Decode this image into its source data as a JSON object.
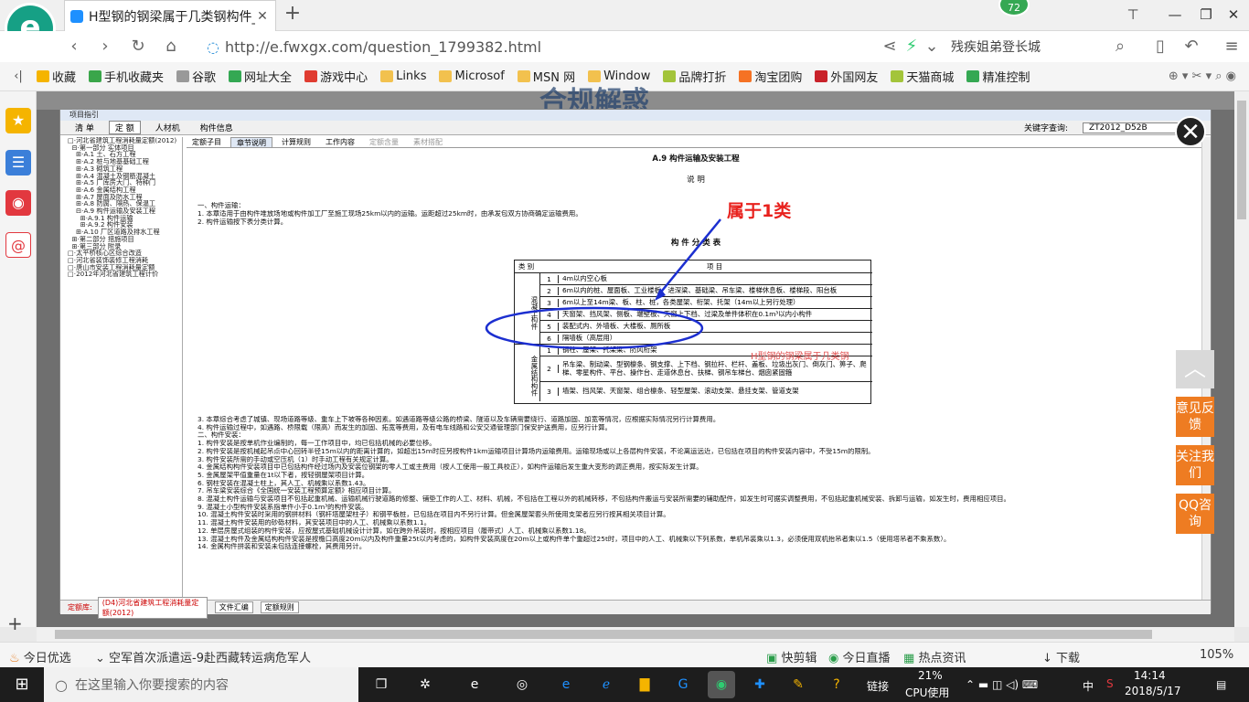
{
  "browser": {
    "logo_glyph": "e",
    "tab_title": "H型钢的钢梁属于几类钢构件_广",
    "tab_close": "✕",
    "new_tab": "+",
    "badge": "72",
    "window_buttons": [
      "⊤",
      "—",
      "❐",
      "✕"
    ],
    "url": "http://e.fwxgx.com/question_1799382.html",
    "search_text": "残疾姐弟登长城",
    "bookmarks": [
      "收藏",
      "手机收藏夹",
      "谷歌",
      "网址大全",
      "游戏中心",
      "Links",
      "Microsof",
      "MSN 网",
      "Window",
      "品牌打折",
      "淘宝团购",
      "外国网友",
      "天猫商城",
      "精准控制"
    ],
    "bookmark_colors": [
      "#f5b400",
      "#3aa64a",
      "#999999",
      "#34a853",
      "#e03c31",
      "#f2c14e",
      "#f2c14e",
      "#f2c14e",
      "#f2c14e",
      "#a3c43a",
      "#f57224",
      "#c9222a",
      "#a3c43a",
      "#35a853"
    ]
  },
  "page": {
    "header_text": "合规解惑",
    "annotation": "属于1类",
    "watermark": "H型钢的钢梁属于几类钢",
    "close_glyph": "✕",
    "back_to_top": "︿",
    "side_buttons": [
      "意见反馈",
      "关注我们",
      "QQ咨询"
    ]
  },
  "app": {
    "title": "项目指引",
    "toolbar": [
      "清 单",
      "定 额",
      "人材机",
      "构件信息"
    ],
    "search_label": "关键字查询:",
    "search_value": "ZT2012_D52B",
    "tree": [
      "□·河北省建筑工程消耗量定额(2012)",
      "  ⊟·第一部分 实体项目",
      "    ⊞·A.1 土、石方工程",
      "    ⊞·A.2 桩与地基基础工程",
      "    ⊞·A.3 砌筑工程",
      "    ⊞·A.4 混凝土及钢筋混凝土",
      "    ⊞·A.5 厂库房大门、特种门",
      "    ⊞·A.6 金属结构工程",
      "    ⊞·A.7 屋面及防水工程",
      "    ⊞·A.8 防腐、隔热、保温工",
      "    ⊟·A.9 构件运输及安装工程",
      "      ⊞·A.9.1 构件运输",
      "      ⊞·A.9.2 构件安装",
      "    ⊞·A.10 厂区道路及排水工程",
      "  ⊞·第二部分 措施项目",
      "  ⊞·第三部分 附录",
      "□·太平桥核心区综合改造",
      "□·河北省装饰装修工程消耗",
      "□·唐山市安装工程消耗量定额",
      "□·2012年河北省建筑工程计价"
    ],
    "subtabs": [
      "定额子目",
      "章节说明",
      "计算规则",
      "工作内容",
      "定额含量",
      "素材搭配"
    ],
    "doc_title": "A.9 构件运输及安装工程",
    "doc_sub": "说 明",
    "para1": [
      "一、构件运输：",
      "1. 本章适用于由构件堆放场地或构件加工厂至施工现场25km以内的运输。运距超过25km时，由承发包双方协商确定运输费用。",
      "2. 构件运输按下表分类计算。"
    ],
    "table_title": "构 件 分 类 表",
    "table_head": [
      "类 别",
      "项 目"
    ],
    "table_rows": [
      {
        "num": "1",
        "text": "4m以内空心板"
      },
      {
        "num": "2",
        "text": "6m以内的桩、屋面板、工业楼板、进深梁、基础梁、吊车梁、楼梯休息板、楼梯段、阳台板"
      },
      {
        "num": "3",
        "text": "6m以上至14m梁、板、柱、桩，各类屋架、桁架、托架（14m以上另行处理）"
      },
      {
        "num": "4",
        "text": "天窗架、挡风架、侧板、端壁板、天窗上下档、过梁及单件体积在0.1m³以内小构件"
      },
      {
        "num": "5",
        "text": "装配式内、外墙板、大楼板、厕所板"
      },
      {
        "num": "6",
        "text": "隔墙板（高层用）"
      },
      {
        "num": "1",
        "text": "钢柱、屋架、托架梁、防风桁架"
      },
      {
        "num": "2",
        "text": "吊车梁、制动梁、型钢檩条、钢支撑、上下档、钢拉杆、栏杆、盖板、垃圾出灰门、倒灰门、箅子、爬梯、零星构件、平台、操作台、走道休息台、扶梯、钢吊车梯台、烟囱紧固箍"
      },
      {
        "num": "3",
        "text": "墙架、挡风架、天窗架、组合檩条、轻型屋架、滚动支架、悬挂支架、管道支架"
      }
    ],
    "cat_concrete": "混凝土构件",
    "cat_metal": "金属结构构件",
    "para2": [
      "3. 本章综合考虑了城镇、现场道路等级、重车上下坡等各种因素。如遇道路等级公路的桥梁、隧道以及车辆需要绕行、道路加固、加宽等情况，应根据实际情况另行计算费用。",
      "4. 构件运输过程中，如遇路、桥限载（限高）而发生的加固、拓宽等费用，及有电车线路和公安交通管理部门保安护送费用，应另行计算。",
      "二、构件安装：",
      "1. 构件安装是按单机作业编制的，每一工作项目中，均已包括机械的必要位移。",
      "2. 构件安装是按机械起吊点中心回转半径15m以内的距离计算的，如超出15m时应另按构件1km运输项目计算场内运输费用。运输现场或以上各层构件安装，不论离运远近，已包括在项目的构件安装内容中，不受15m的限制。",
      "3. 构件安装所需的手动或空压机（1）时手动工程有关规定计算。",
      "4. 金属结构构件安装项目中已包括构件经过场内及安装位钢架的零人工或主费用（按人工使用一般工具校正），如构件运输后发生重大变形的调正费用，按实际发生计算。",
      "5. 金属屋架平值重量在1t以下者，按轻钢屋架项目计算。",
      "6. 钢柱安装在混凝土柱上，其人工、机械乘以系数1.43。",
      "7. 吊车梁安装综合《全国统一安装工程预算定额》相应项目计算。",
      "8. 混凝土构件运输与安装项目不包括起重机械、运输机械行驶道路的修整、铺垫工作的人工、材料、机械，不包括在工程以外的机械转移，不包括构件搬运与安装所需要的辅助配件，如发生时可据实调整费用，不包括起重机械安装、拆卸与运输，如发生时，费用相应项目。",
      "9. 混凝土小型构件安装系指单件小于0.1m³的构件安装。",
      "10. 混凝土构件安装时采用的钢拼材料（钢杆塔屋架柱子）和钢平板桩，已包括在项目内不另行计算。但金属屋架套头所使用支架者应另行按其相关项目计算。",
      "11. 混凝土构件安装用的砂砾材料，其安装项目中的人工、机械乘以系数1.1。",
      "12. 单层房屋式组装的构件安装，应按屋式基础机械设计计算，如在跨外吊装时，按相应项目（履带式）人工、机械乘以系数1.18。",
      "13. 混凝土构件及金属结构构件安装是按檐口高度20m以内及构件重量25t以内考虑的，如构件安装高度在20m以上或构件单个重超过25t时，项目中的人工、机械乘以下列系数，单机吊装乘以1.3，必须使用双机抬吊者乘以1.5（使用塔吊者不乘系数）。",
      "14. 金属构件拼装和安装未包括连接螺栓，其费用另计。"
    ],
    "footer_label": "定额库:",
    "footer_value": "(D4)河北省建筑工程消耗量定额(2012)",
    "footer_buttons": [
      "文件汇编",
      "定额规则"
    ]
  },
  "status": {
    "left": "今日优选",
    "news": "空军首次派遣运-9赴西藏转运病危军人",
    "items": [
      "快剪辑",
      "今日直播",
      "热点资讯",
      "下载"
    ],
    "zoom": "105%"
  },
  "taskbar": {
    "search_placeholder": "在这里输入你要搜索的内容",
    "cpu_value": "21%",
    "cpu_label": "CPU使用",
    "link_label": "链接",
    "ime": "中",
    "time": "14:14",
    "date": "2018/5/17"
  }
}
